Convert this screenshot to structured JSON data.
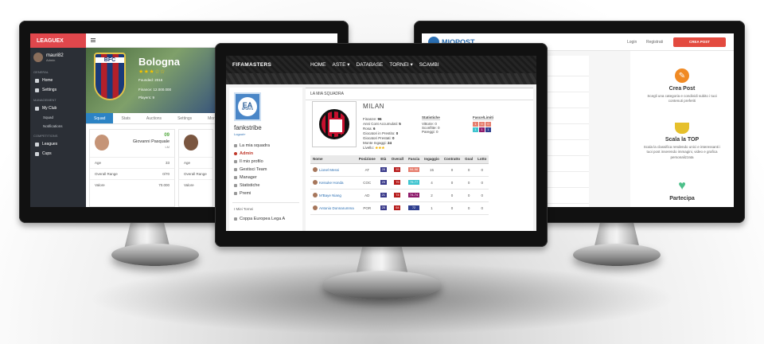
{
  "leaguex": {
    "logo": "LEAGUEX",
    "user": {
      "name": "mauri82",
      "role": "Admin"
    },
    "sections": [
      "GENERAL",
      "MANAGEMENT",
      "COMPETITIONS"
    ],
    "general_items": [
      "Home",
      "Settings"
    ],
    "management_items": [
      "My Club",
      "Squad",
      "Notifications"
    ],
    "competition_items": [
      "Leagues",
      "Cups"
    ],
    "club": {
      "crest_text": "BFC",
      "name": "Bologna",
      "stars": "★★★☆☆",
      "founded": "Founded: 2016",
      "finance": "Finance: 12.000.000",
      "players": "Players: 9"
    },
    "tabs": [
      "Squad",
      "Stats",
      "Auctions",
      "Settings",
      "More"
    ],
    "player": {
      "number": "09",
      "name": "Giovanni Pasquale",
      "position": "LM"
    },
    "rows": [
      {
        "label": "Age",
        "value": "33"
      },
      {
        "label": "Overall Range",
        "value": "0/70"
      },
      {
        "label": "Valore",
        "value": "70.000"
      }
    ],
    "rows_short": [
      "Age",
      "Overall Range",
      "Valore"
    ]
  },
  "fifamasters": {
    "logo": "FIFAMASTERS",
    "menu": [
      "HOME",
      "ASTE ▾",
      "DATABASE",
      "TORNEI ▾",
      "SCAMBI"
    ],
    "user": {
      "name": "fankstribe",
      "link": "Logout»"
    },
    "nav": [
      "La mia squadra",
      "Admin",
      "Il mio profilo",
      "Gestisci Team",
      "Manager",
      "Statistiche",
      "Premi"
    ],
    "tornei_title": "I Miei Tornei",
    "tornei": [
      "Coppa Europea Lega A"
    ],
    "section_title": "LA MIA SQUADRA",
    "club": "MILAN",
    "stats": [
      {
        "label": "Finanze:",
        "value": "96"
      },
      {
        "label": "Anni Cont Accumulati:",
        "value": "5"
      },
      {
        "label": "Rosa:",
        "value": "6"
      },
      {
        "label": "Giocatori in Prestito:",
        "value": "0"
      },
      {
        "label": "Giocatori Prestati:",
        "value": "0"
      },
      {
        "label": "Monte Ingaggi:",
        "value": "24"
      },
      {
        "label": "Livello:",
        "value": "★★★"
      }
    ],
    "statistiche": {
      "title": "Statistiche",
      "items": [
        "Vittorie: 0",
        "Sconfitte: 0",
        "Pareggi: 0"
      ]
    },
    "fasce": {
      "title": "Fasce/Limiti",
      "row1": [
        "1",
        "0",
        "0"
      ],
      "row2": [
        "1",
        "1",
        "1"
      ]
    },
    "table": {
      "headers": [
        "Nome",
        "Posizione",
        "Età",
        "Overall",
        "Fascia",
        "Ingaggio",
        "Contratto",
        "Goal",
        "Lotto"
      ],
      "rows": [
        {
          "name": "Lionel Messi",
          "pos": "AT",
          "eta": "28",
          "ovr": "93",
          "fascia": "94-96",
          "fascia_color": "#e67e6e",
          "ingaggio": "15",
          "contratto": "0",
          "goal": "0",
          "lotto": "0"
        },
        {
          "name": "Keisuke Honda",
          "pos": "COC",
          "eta": "29",
          "ovr": "79",
          "fascia": "79-77",
          "fascia_color": "#3fc4cf",
          "ingaggio": "4",
          "contratto": "0",
          "goal": "0",
          "lotto": "0"
        },
        {
          "name": "M'Baye Niang",
          "pos": "AD",
          "eta": "21",
          "ovr": "74",
          "fascia": "74-74",
          "fascia_color": "#8e1b6b",
          "ingaggio": "2",
          "contratto": "0",
          "goal": "0",
          "lotto": "0"
        },
        {
          "name": "Antonio Donnarumma",
          "pos": "POR",
          "eta": "25",
          "ovr": "64",
          "fascia": "72",
          "fascia_color": "#2f3f8f",
          "ingaggio": "1",
          "contratto": "0",
          "goal": "0",
          "lotto": "0"
        }
      ]
    }
  },
  "miopost": {
    "logo": "MIOPOST",
    "login": "Login",
    "register": "Registrati",
    "cta": "CREA POST",
    "features": [
      {
        "title": "Crea Post",
        "text": "Scegli una categoria e condividi subito i tuoi contenuti preferiti"
      },
      {
        "title": "Scala la TOP",
        "text": "Scala la classifica rendendo unici e interessanti i tuoi post inserendo immagini, video e grafica personalizzata"
      },
      {
        "title": "Partecipa",
        "text": ""
      }
    ]
  },
  "colors": {
    "leaguex_red": "#e0474c",
    "miopost_blue": "#2b6fb3",
    "cta_red": "#e34a3f",
    "milan_red": "#c8102e"
  }
}
